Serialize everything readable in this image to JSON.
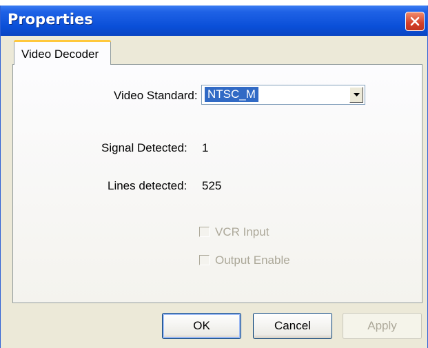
{
  "window": {
    "title": "Properties"
  },
  "tabs": [
    {
      "label": "Video Decoder",
      "active": true
    }
  ],
  "fields": {
    "video_standard": {
      "label": "Video Standard:",
      "value": "NTSC_M"
    },
    "signal_detected": {
      "label": "Signal Detected:",
      "value": "1"
    },
    "lines_detected": {
      "label": "Lines detected:",
      "value": "525"
    }
  },
  "checkboxes": [
    {
      "label": "VCR Input",
      "checked": false,
      "enabled": false
    },
    {
      "label": "Output Enable",
      "checked": false,
      "enabled": false
    }
  ],
  "buttons": {
    "ok": "OK",
    "cancel": "Cancel",
    "apply": "Apply"
  },
  "colors": {
    "titlebar": "#0a4fd8",
    "close": "#d4402a",
    "selection": "#316ac5",
    "tab_accent": "#ffc83c"
  },
  "icons": {
    "close": "close-icon",
    "dropdown": "chevron-down-icon"
  }
}
